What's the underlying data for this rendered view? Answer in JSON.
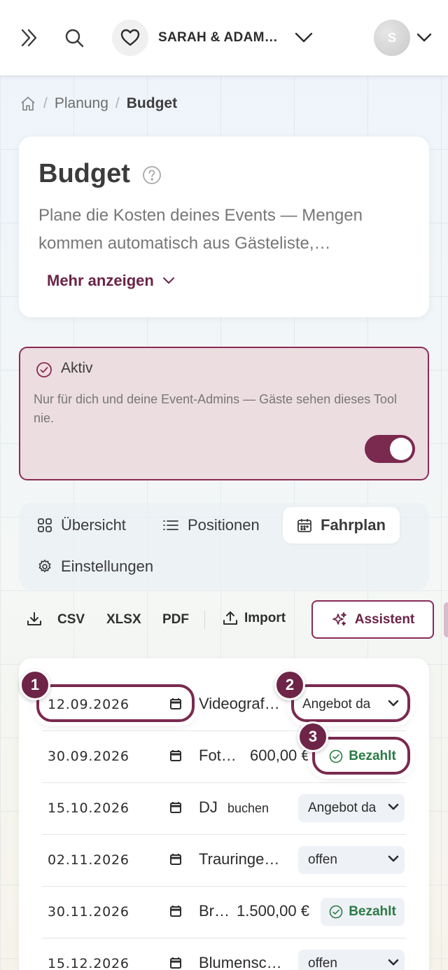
{
  "topbar": {
    "event_name": "SARAH & ADAM…",
    "avatar_initial": "S"
  },
  "breadcrumb": {
    "items": [
      "Planung",
      "Budget"
    ]
  },
  "header": {
    "title": "Budget",
    "description": "Plane die Kosten deines Events — Mengen kommen automatisch aus Gästeliste,…",
    "more_label": "Mehr anzeigen"
  },
  "active": {
    "title": "Aktiv",
    "description": "Nur für dich und deine Event-Admins — Gäste sehen dieses Tool nie.",
    "toggle_on": true
  },
  "tabs": [
    {
      "label": "Übersicht",
      "active": false
    },
    {
      "label": "Positionen",
      "active": false
    },
    {
      "label": "Fahrplan",
      "active": true
    },
    {
      "label": "Einstellungen",
      "active": false
    }
  ],
  "toolbar": {
    "csv": "CSV",
    "xlsx": "XLSX",
    "pdf": "PDF",
    "import": "Import",
    "assistant": "Assistent"
  },
  "rows": [
    {
      "date": "12.09.2026",
      "title": "Videograf…",
      "status": "Angebot da"
    },
    {
      "date": "30.09.2026",
      "title": "Fot…",
      "amount": "600,00 €",
      "status": "Bezahlt"
    },
    {
      "date": "15.10.2026",
      "title": "DJ",
      "subtitle": "buchen",
      "status": "Angebot da"
    },
    {
      "date": "02.11.2026",
      "title": "Trauringe…",
      "status": "offen"
    },
    {
      "date": "30.11.2026",
      "title": "Br…",
      "amount": "1.500,00 €",
      "status": "Bezahlt"
    },
    {
      "date": "15.12.2026",
      "title": "Blumensc…",
      "status": "offen"
    }
  ],
  "highlights": [
    "1",
    "2",
    "3"
  ],
  "colors": {
    "brand": "#7a2a4f",
    "paid": "#2a7a45",
    "active_bg": "#ecdde1"
  }
}
